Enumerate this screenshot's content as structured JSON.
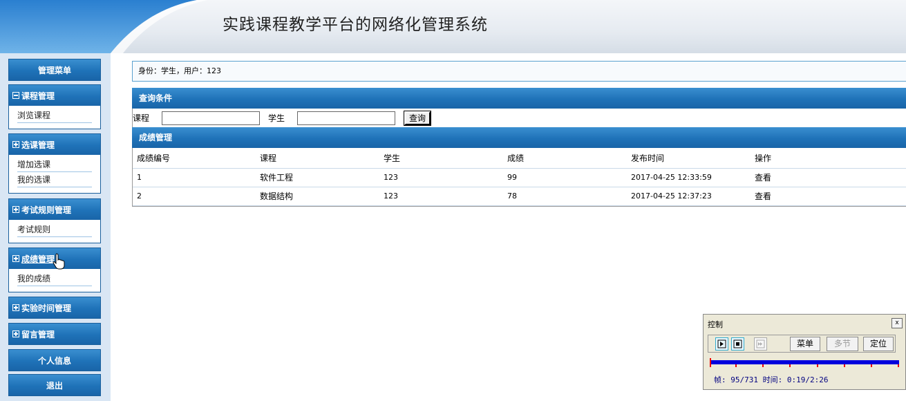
{
  "header": {
    "title": "实践课程教学平台的网络化管理系统"
  },
  "sidebar": {
    "menu_label": "管理菜单",
    "panels": [
      {
        "title": "课程管理",
        "expanded": true,
        "items": [
          "浏览课程"
        ]
      },
      {
        "title": "选课管理",
        "expanded": false,
        "items": [
          "增加选课",
          "我的选课"
        ]
      },
      {
        "title": "考试规则管理",
        "expanded": false,
        "items": [
          "考试规则"
        ]
      },
      {
        "title": "成绩管理",
        "expanded": false,
        "items": [
          "我的成绩"
        ]
      },
      {
        "title": "实验时间管理",
        "expanded": false,
        "items": []
      },
      {
        "title": "留言管理",
        "expanded": false,
        "items": []
      }
    ],
    "profile_label": "个人信息",
    "logout_label": "退出"
  },
  "identity": {
    "text": "身份：学生，用户：123"
  },
  "query": {
    "title": "查询条件",
    "course_label": "课程",
    "course_value": "",
    "student_label": "学生",
    "student_value": "",
    "button_label": "查询"
  },
  "grades": {
    "title": "成绩管理",
    "columns": [
      "成绩编号",
      "课程",
      "学生",
      "成绩",
      "发布时间",
      "操作"
    ],
    "rows": [
      {
        "id": "1",
        "course": "软件工程",
        "student": "123",
        "score": "99",
        "time": "2017-04-25 12:33:59",
        "action": "查看"
      },
      {
        "id": "2",
        "course": "数据结构",
        "student": "123",
        "score": "78",
        "time": "2017-04-25 12:37:23",
        "action": "查看"
      }
    ]
  },
  "control": {
    "title": "控制",
    "close_label": "x",
    "menu_label": "菜单",
    "multi_label": "多节",
    "locate_label": "定位",
    "status": "帧: 95/731 时间: 0:19/2:26",
    "progress": 0.13
  },
  "colors": {
    "accent": "#1f72b8",
    "sidebar_bg": "#d9e6f4",
    "track": "#0000dd",
    "tick": "#ee0000"
  }
}
